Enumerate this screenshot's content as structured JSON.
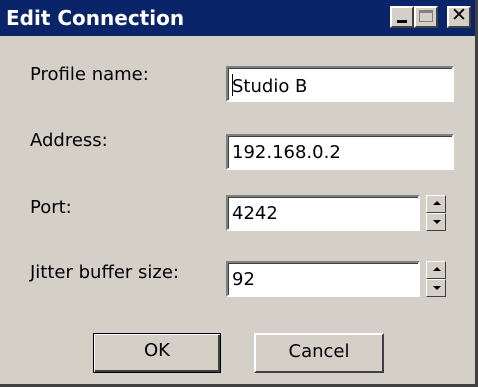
{
  "window": {
    "title": "Edit Connection",
    "controls": {
      "minimize_icon": "minimize-icon",
      "maximize_icon": "maximize-icon",
      "close_icon": "close-icon"
    }
  },
  "form": {
    "profile_name": {
      "label": "Profile name:",
      "value": "Studio B"
    },
    "address": {
      "label": "Address:",
      "value": "192.168.0.2"
    },
    "port": {
      "label": "Port:",
      "value": "4242"
    },
    "jitter_buffer": {
      "label": "Jitter buffer size:",
      "value": "92"
    }
  },
  "buttons": {
    "ok": "OK",
    "cancel": "Cancel"
  },
  "colors": {
    "titlebar": "#0a246a",
    "dialog_face": "#d4d0c8",
    "field_background": "#ffffff"
  }
}
